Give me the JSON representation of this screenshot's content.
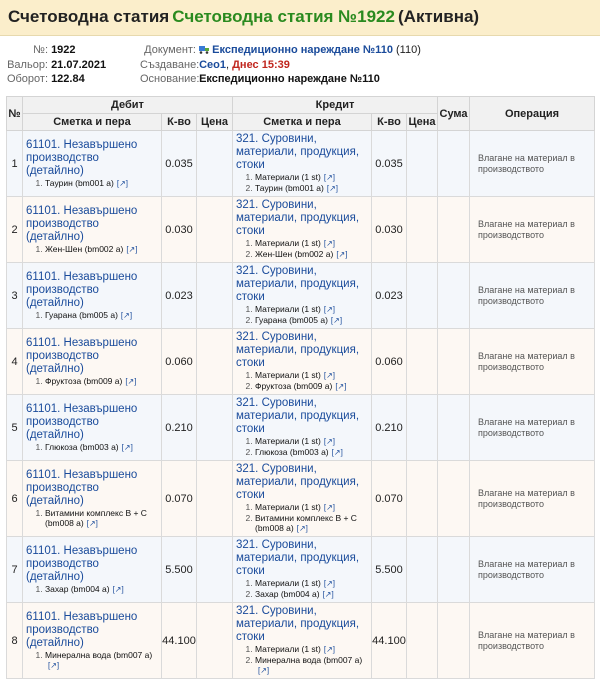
{
  "header": {
    "prefix": "Счетоводна статия",
    "title": "Счетоводна статия №1922",
    "status": "(Активна)"
  },
  "meta": {
    "number_label": "№:",
    "number": "1922",
    "valor_label": "Вальор:",
    "valor": "21.07.2021",
    "turnover_label": "Оборот:",
    "turnover": "122.84",
    "document_label": "Документ:",
    "document_link": "Експедиционно нареждане №110",
    "document_count": "(110)",
    "created_label": "Създаване:",
    "created_user": "Ceo1",
    "created_sep": ",",
    "created_when": "Днес 15:39",
    "basis_label": "Основание:",
    "basis": "Експедиционно нареждане №110"
  },
  "table": {
    "col_num": "№",
    "col_debit": "Дебит",
    "col_credit": "Кредит",
    "col_sum": "Сума",
    "col_operation": "Операция",
    "sub_account": "Сметка и пера",
    "sub_qty": "К-во",
    "sub_price": "Цена",
    "ext_icon": "[↗]",
    "rows": [
      {
        "n": "1",
        "debit_account": "61101. Незавършено производство (детайлно)",
        "debit_items": [
          "Таурин (bm001 а)"
        ],
        "debit_qty": "0.035",
        "credit_account": "321. Суровини, материали, продукция, стоки",
        "credit_items": [
          "Материали (1 st)",
          "Таурин (bm001 а)"
        ],
        "credit_qty": "0.035",
        "operation": "Влагане на материал в производството"
      },
      {
        "n": "2",
        "debit_account": "61101. Незавършено производство (детайлно)",
        "debit_items": [
          "Жен-Шен (bm002 а)"
        ],
        "debit_qty": "0.030",
        "credit_account": "321. Суровини, материали, продукция, стоки",
        "credit_items": [
          "Материали (1 st)",
          "Жен-Шен (bm002 а)"
        ],
        "credit_qty": "0.030",
        "operation": "Влагане на материал в производството"
      },
      {
        "n": "3",
        "debit_account": "61101. Незавършено производство (детайлно)",
        "debit_items": [
          "Гуарана (bm005 а)"
        ],
        "debit_qty": "0.023",
        "credit_account": "321. Суровини, материали, продукция, стоки",
        "credit_items": [
          "Материали (1 st)",
          "Гуарана (bm005 а)"
        ],
        "credit_qty": "0.023",
        "operation": "Влагане на материал в производството"
      },
      {
        "n": "4",
        "debit_account": "61101. Незавършено производство (детайлно)",
        "debit_items": [
          "Фруктоза (bm009 а)"
        ],
        "debit_qty": "0.060",
        "credit_account": "321. Суровини, материали, продукция, стоки",
        "credit_items": [
          "Материали (1 st)",
          "Фруктоза (bm009 а)"
        ],
        "credit_qty": "0.060",
        "operation": "Влагане на материал в производството"
      },
      {
        "n": "5",
        "debit_account": "61101. Незавършено производство (детайлно)",
        "debit_items": [
          "Глюкоза (bm003 а)"
        ],
        "debit_qty": "0.210",
        "credit_account": "321. Суровини, материали, продукция, стоки",
        "credit_items": [
          "Материали (1 st)",
          "Глюкоза (bm003 а)"
        ],
        "credit_qty": "0.210",
        "operation": "Влагане на материал в производството"
      },
      {
        "n": "6",
        "debit_account": "61101. Незавършено производство (детайлно)",
        "debit_items": [
          "Витамини комплекс B + C (bm008 а)"
        ],
        "debit_qty": "0.070",
        "credit_account": "321. Суровини, материали, продукция, стоки",
        "credit_items": [
          "Материали (1 st)",
          "Витамини комплекс B + C (bm008 а)"
        ],
        "credit_qty": "0.070",
        "operation": "Влагане на материал в производството"
      },
      {
        "n": "7",
        "debit_account": "61101. Незавършено производство (детайлно)",
        "debit_items": [
          "Захар (bm004 а)"
        ],
        "debit_qty": "5.500",
        "credit_account": "321. Суровини, материали, продукция, стоки",
        "credit_items": [
          "Материали (1 st)",
          "Захар (bm004 а)"
        ],
        "credit_qty": "5.500",
        "operation": "Влагане на материал в производството"
      },
      {
        "n": "8",
        "debit_account": "61101. Незавършено производство (детайлно)",
        "debit_items": [
          "Минерална вода (bm007 а)"
        ],
        "debit_qty": "44.100",
        "credit_account": "321. Суровини, материали, продукция, стоки",
        "credit_items": [
          "Материали (1 st)",
          "Минерална вода (bm007 а)"
        ],
        "credit_qty": "44.100",
        "operation": "Влагане на материал в производството"
      }
    ]
  }
}
